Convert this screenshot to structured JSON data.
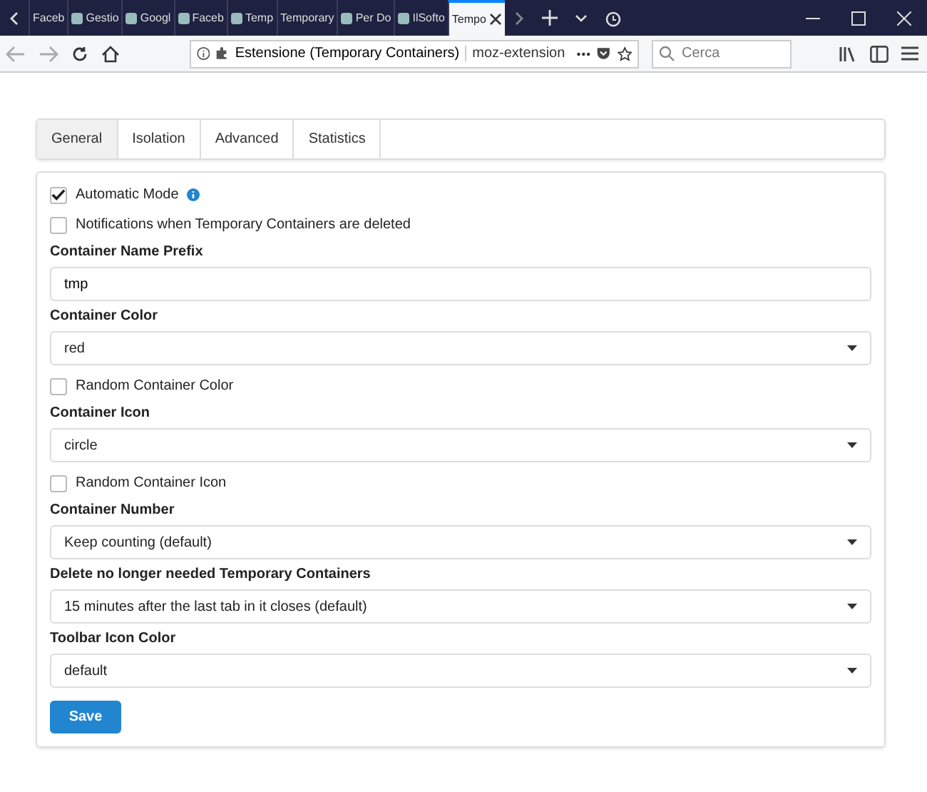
{
  "browser_tabs": [
    {
      "label": "Faceb",
      "icon": false,
      "selected": false
    },
    {
      "label": "Gestio",
      "icon": true,
      "selected": false
    },
    {
      "label": "Googl",
      "icon": true,
      "selected": false
    },
    {
      "label": "Faceb",
      "icon": true,
      "selected": false
    },
    {
      "label": "Temp",
      "icon": true,
      "selected": false
    },
    {
      "label": "Temporary",
      "icon": false,
      "selected": false
    },
    {
      "label": "Per Do",
      "icon": true,
      "selected": false
    },
    {
      "label": "IlSofto",
      "icon": true,
      "selected": false
    },
    {
      "label": "Tempo",
      "icon": false,
      "selected": true
    }
  ],
  "address_bar": {
    "identity": "Estensione (Temporary Containers)",
    "url": "moz-extension"
  },
  "search": {
    "placeholder": "Cerca"
  },
  "tabs": [
    {
      "label": "General",
      "selected": true
    },
    {
      "label": "Isolation",
      "selected": false
    },
    {
      "label": "Advanced",
      "selected": false
    },
    {
      "label": "Statistics",
      "selected": false
    }
  ],
  "fields": [
    {
      "kind": "checkbox",
      "label": "Automatic Mode",
      "checked": true,
      "info": true
    },
    {
      "kind": "checkbox",
      "label": "Notifications when Temporary Containers are deleted",
      "checked": false,
      "info": false
    },
    {
      "kind": "text",
      "label": "Container Name Prefix",
      "value": "tmp"
    },
    {
      "kind": "select",
      "label": "Container Color",
      "value": "red"
    },
    {
      "kind": "checkbox",
      "label": "Random Container Color",
      "checked": false,
      "info": false
    },
    {
      "kind": "select",
      "label": "Container Icon",
      "value": "circle"
    },
    {
      "kind": "checkbox",
      "label": "Random Container Icon",
      "checked": false,
      "info": false
    },
    {
      "kind": "select",
      "label": "Container Number",
      "value": "Keep counting (default)"
    },
    {
      "kind": "select",
      "label": "Delete no longer needed Temporary Containers",
      "value": "15 minutes after the last tab in it closes (default)"
    },
    {
      "kind": "select",
      "label": "Toolbar Icon Color",
      "value": "default"
    }
  ],
  "save_button": "Save"
}
